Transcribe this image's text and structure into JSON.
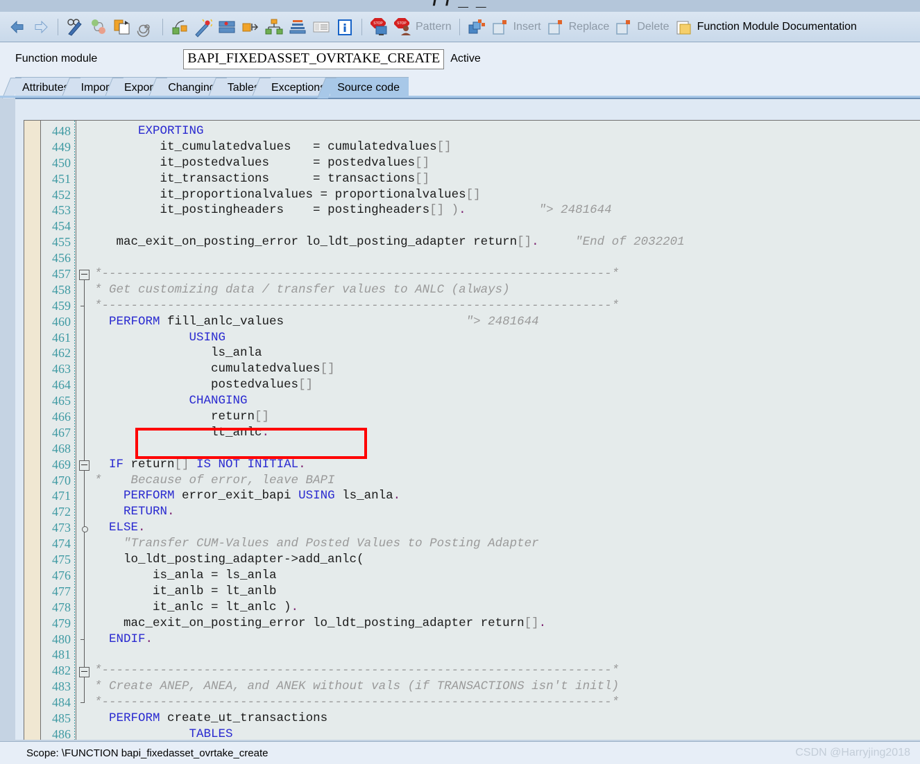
{
  "window": {
    "title_fragment": "/ /  _            _"
  },
  "toolbar": {
    "icons": [
      {
        "name": "back-arrow-icon",
        "glyph": "back"
      },
      {
        "name": "forward-arrow-icon",
        "glyph": "forward"
      },
      {
        "name": "display-change-icon",
        "glyph": "glasses-pen"
      },
      {
        "name": "other-object-icon",
        "glyph": "two-balls"
      },
      {
        "name": "copy-icon",
        "glyph": "copy"
      },
      {
        "name": "pattern-spiral-icon",
        "glyph": "spiral"
      },
      {
        "name": "check-icon",
        "glyph": "check-blocks"
      },
      {
        "name": "pretty-printer-icon",
        "glyph": "magic-wand"
      },
      {
        "name": "activate-icon",
        "glyph": "activate"
      },
      {
        "name": "where-used-icon",
        "glyph": "where-used"
      },
      {
        "name": "structure-icon",
        "glyph": "hierarchy"
      },
      {
        "name": "sort-icon",
        "glyph": "stack"
      },
      {
        "name": "list-icon",
        "glyph": "list"
      },
      {
        "name": "information-icon",
        "glyph": "info"
      },
      {
        "name": "breakpoint-icon",
        "glyph": "stop-monitor"
      },
      {
        "name": "debug-icon",
        "glyph": "stop-user"
      }
    ],
    "pattern_label": "Pattern",
    "insert_group_icon": "insert-block-icon",
    "insert_label": "Insert",
    "replace_label": "Replace",
    "delete_label": "Delete",
    "documentation_icon": "documentation-icon",
    "documentation_label": "Function Module Documentation"
  },
  "function_module": {
    "label": "Function module",
    "value": "BAPI_FIXEDASSET_OVRTAKE_CREATE",
    "status": "Active"
  },
  "tabs": [
    {
      "label": "Attributes",
      "selected": false
    },
    {
      "label": "Import",
      "selected": false
    },
    {
      "label": "Export",
      "selected": false
    },
    {
      "label": "Changing",
      "selected": false
    },
    {
      "label": "Tables",
      "selected": false
    },
    {
      "label": "Exceptions",
      "selected": false
    },
    {
      "label": "Source code",
      "selected": true
    }
  ],
  "editor": {
    "first_line": 448,
    "lines": [
      {
        "n": 448,
        "tokens": [
          {
            "t": "      ",
            "c": "id"
          },
          {
            "t": "EXPORTING",
            "c": "kw"
          }
        ]
      },
      {
        "n": 449,
        "tokens": [
          {
            "t": "         it_cumulatedvalues",
            "c": "id"
          },
          {
            "t": "   = ",
            "c": "op"
          },
          {
            "t": "cumulatedvalues",
            "c": "id"
          },
          {
            "t": "[]",
            "c": "br"
          }
        ]
      },
      {
        "n": 450,
        "tokens": [
          {
            "t": "         it_postedvalues",
            "c": "id"
          },
          {
            "t": "      = ",
            "c": "op"
          },
          {
            "t": "postedvalues",
            "c": "id"
          },
          {
            "t": "[]",
            "c": "br"
          }
        ]
      },
      {
        "n": 451,
        "tokens": [
          {
            "t": "         it_transactions",
            "c": "id"
          },
          {
            "t": "      = ",
            "c": "op"
          },
          {
            "t": "transactions",
            "c": "id"
          },
          {
            "t": "[]",
            "c": "br"
          }
        ]
      },
      {
        "n": 452,
        "tokens": [
          {
            "t": "         it_proportionalvalues = ",
            "c": "id"
          },
          {
            "t": "proportionalvalues",
            "c": "id"
          },
          {
            "t": "[]",
            "c": "br"
          }
        ]
      },
      {
        "n": 453,
        "tokens": [
          {
            "t": "         it_postingheaders",
            "c": "id"
          },
          {
            "t": "    = ",
            "c": "op"
          },
          {
            "t": "postingheaders",
            "c": "id"
          },
          {
            "t": "[] )",
            "c": "br"
          },
          {
            "t": ".",
            "c": "pt"
          },
          {
            "t": "          ",
            "c": "id"
          },
          {
            "t": "\"> 2481644",
            "c": "cm"
          }
        ]
      },
      {
        "n": 454,
        "tokens": []
      },
      {
        "n": 455,
        "tokens": [
          {
            "t": "   mac_exit_on_posting_error lo_ldt_posting_adapter return",
            "c": "id"
          },
          {
            "t": "[]",
            "c": "br"
          },
          {
            "t": ".",
            "c": "pt"
          },
          {
            "t": "     ",
            "c": "id"
          },
          {
            "t": "\"End of 2032201",
            "c": "cm"
          }
        ]
      },
      {
        "n": 456,
        "tokens": []
      },
      {
        "n": 457,
        "tokens": [
          {
            "t": "*----------------------------------------------------------------------*",
            "c": "cm"
          }
        ]
      },
      {
        "n": 458,
        "tokens": [
          {
            "t": "* Get customizing data / transfer values to ANLC (always)",
            "c": "cm"
          }
        ]
      },
      {
        "n": 459,
        "tokens": [
          {
            "t": "*----------------------------------------------------------------------*",
            "c": "cm"
          }
        ]
      },
      {
        "n": 460,
        "tokens": [
          {
            "t": "  PERFORM ",
            "c": "kw"
          },
          {
            "t": "fill_anlc_values",
            "c": "id"
          },
          {
            "t": "                         ",
            "c": "id"
          },
          {
            "t": "\"> 2481644",
            "c": "cm"
          }
        ]
      },
      {
        "n": 461,
        "tokens": [
          {
            "t": "             USING",
            "c": "kw"
          }
        ]
      },
      {
        "n": 462,
        "tokens": [
          {
            "t": "                ls_anla",
            "c": "id"
          }
        ]
      },
      {
        "n": 463,
        "tokens": [
          {
            "t": "                cumulatedvalues",
            "c": "id"
          },
          {
            "t": "[]",
            "c": "br"
          }
        ]
      },
      {
        "n": 464,
        "tokens": [
          {
            "t": "                postedvalues",
            "c": "id"
          },
          {
            "t": "[]",
            "c": "br"
          }
        ]
      },
      {
        "n": 465,
        "tokens": [
          {
            "t": "             CHANGING",
            "c": "kw"
          }
        ]
      },
      {
        "n": 466,
        "tokens": [
          {
            "t": "                return",
            "c": "id"
          },
          {
            "t": "[]",
            "c": "br"
          }
        ]
      },
      {
        "n": 467,
        "tokens": [
          {
            "t": "                lt_anlc",
            "c": "id"
          },
          {
            "t": ".",
            "c": "pt"
          }
        ]
      },
      {
        "n": 468,
        "tokens": []
      },
      {
        "n": 469,
        "tokens": [
          {
            "t": "  IF ",
            "c": "kw"
          },
          {
            "t": "return",
            "c": "id"
          },
          {
            "t": "[]",
            "c": "br"
          },
          {
            "t": " IS NOT INITIAL",
            "c": "kw"
          },
          {
            "t": ".",
            "c": "pt"
          }
        ]
      },
      {
        "n": 470,
        "tokens": [
          {
            "t": "*    Because of error, leave BAPI",
            "c": "cm"
          }
        ]
      },
      {
        "n": 471,
        "tokens": [
          {
            "t": "    PERFORM ",
            "c": "kw"
          },
          {
            "t": "error_exit_bapi ",
            "c": "id"
          },
          {
            "t": "USING ",
            "c": "kw"
          },
          {
            "t": "ls_anla",
            "c": "id"
          },
          {
            "t": ".",
            "c": "pt"
          }
        ]
      },
      {
        "n": 472,
        "tokens": [
          {
            "t": "    RETURN",
            "c": "kw"
          },
          {
            "t": ".",
            "c": "pt"
          }
        ]
      },
      {
        "n": 473,
        "tokens": [
          {
            "t": "  ELSE",
            "c": "kw"
          },
          {
            "t": ".",
            "c": "pt"
          }
        ]
      },
      {
        "n": 474,
        "tokens": [
          {
            "t": "    \"Transfer CUM-Values and Posted Values to Posting Adapter",
            "c": "cm"
          }
        ]
      },
      {
        "n": 475,
        "tokens": [
          {
            "t": "    lo_ldt_posting_adapter->add_anlc(",
            "c": "id"
          }
        ]
      },
      {
        "n": 476,
        "tokens": [
          {
            "t": "        is_anla = ls_anla",
            "c": "id"
          }
        ]
      },
      {
        "n": 477,
        "tokens": [
          {
            "t": "        it_anlb = lt_anlb",
            "c": "id"
          }
        ]
      },
      {
        "n": 478,
        "tokens": [
          {
            "t": "        it_anlc = lt_anlc )",
            "c": "id"
          },
          {
            "t": ".",
            "c": "pt"
          }
        ]
      },
      {
        "n": 479,
        "tokens": [
          {
            "t": "    mac_exit_on_posting_error lo_ldt_posting_adapter return",
            "c": "id"
          },
          {
            "t": "[]",
            "c": "br"
          },
          {
            "t": ".",
            "c": "pt"
          }
        ]
      },
      {
        "n": 480,
        "tokens": [
          {
            "t": "  ENDIF",
            "c": "kw"
          },
          {
            "t": ".",
            "c": "pt"
          }
        ]
      },
      {
        "n": 481,
        "tokens": []
      },
      {
        "n": 482,
        "tokens": [
          {
            "t": "*----------------------------------------------------------------------*",
            "c": "cm"
          }
        ]
      },
      {
        "n": 483,
        "tokens": [
          {
            "t": "* Create ANEP, ANEA, and ANEK without vals (if TRANSACTIONS isn't initl)",
            "c": "cm"
          }
        ]
      },
      {
        "n": 484,
        "tokens": [
          {
            "t": "*----------------------------------------------------------------------*",
            "c": "cm"
          }
        ]
      },
      {
        "n": 485,
        "tokens": [
          {
            "t": "  PERFORM ",
            "c": "kw"
          },
          {
            "t": "create_ut_transactions",
            "c": "id"
          }
        ]
      },
      {
        "n": 486,
        "tokens": [
          {
            "t": "             TABLES",
            "c": "kw"
          }
        ]
      }
    ]
  },
  "status_bar": {
    "scope": "Scope: \\FUNCTION bapi_fixedasset_ovrtake_create",
    "watermark": "CSDN @Harryjing2018"
  },
  "colors": {
    "keyword": "#2a2ad0",
    "comment": "#9a9a9a",
    "bracket": "#8a8a8a",
    "period": "#7a1f6e",
    "line_number": "#3f9aa3",
    "editor_background": "#e5ebeb",
    "highlight_box": "#ff0000",
    "tab_selected": "#a8c8e8"
  }
}
